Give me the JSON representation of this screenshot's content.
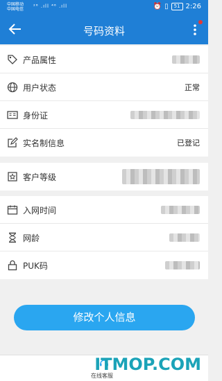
{
  "status": {
    "carrier1": "中国移动",
    "carrier2": "中国电信",
    "signal": "²⁶ .ıll ⁴⁶ .ıll",
    "battery": "51",
    "time": "2:26"
  },
  "appbar": {
    "title": "号码资料"
  },
  "rows": [
    {
      "icon": "tag-icon",
      "label": "产品属性",
      "value": ""
    },
    {
      "icon": "globe-icon",
      "label": "用户状态",
      "value": "正常"
    },
    {
      "icon": "id-card-icon",
      "label": "身份证",
      "value": ""
    },
    {
      "icon": "edit-icon",
      "label": "实名制信息",
      "value": "已登记"
    },
    {
      "icon": "star-badge-icon",
      "label": "客户等级",
      "value": ""
    },
    {
      "icon": "calendar-icon",
      "label": "入网时间",
      "value": ""
    },
    {
      "icon": "hourglass-icon",
      "label": "网龄",
      "value": ""
    },
    {
      "icon": "lock-icon",
      "label": "PUK码",
      "value": ""
    }
  ],
  "button": {
    "label": "修改个人信息"
  },
  "bottom": {
    "service_label": "在线客服"
  },
  "watermark": "ITMOP.COM",
  "colors": {
    "accent": "#1f7fd6",
    "button": "#2aa6f0",
    "badge": "#e53935"
  }
}
